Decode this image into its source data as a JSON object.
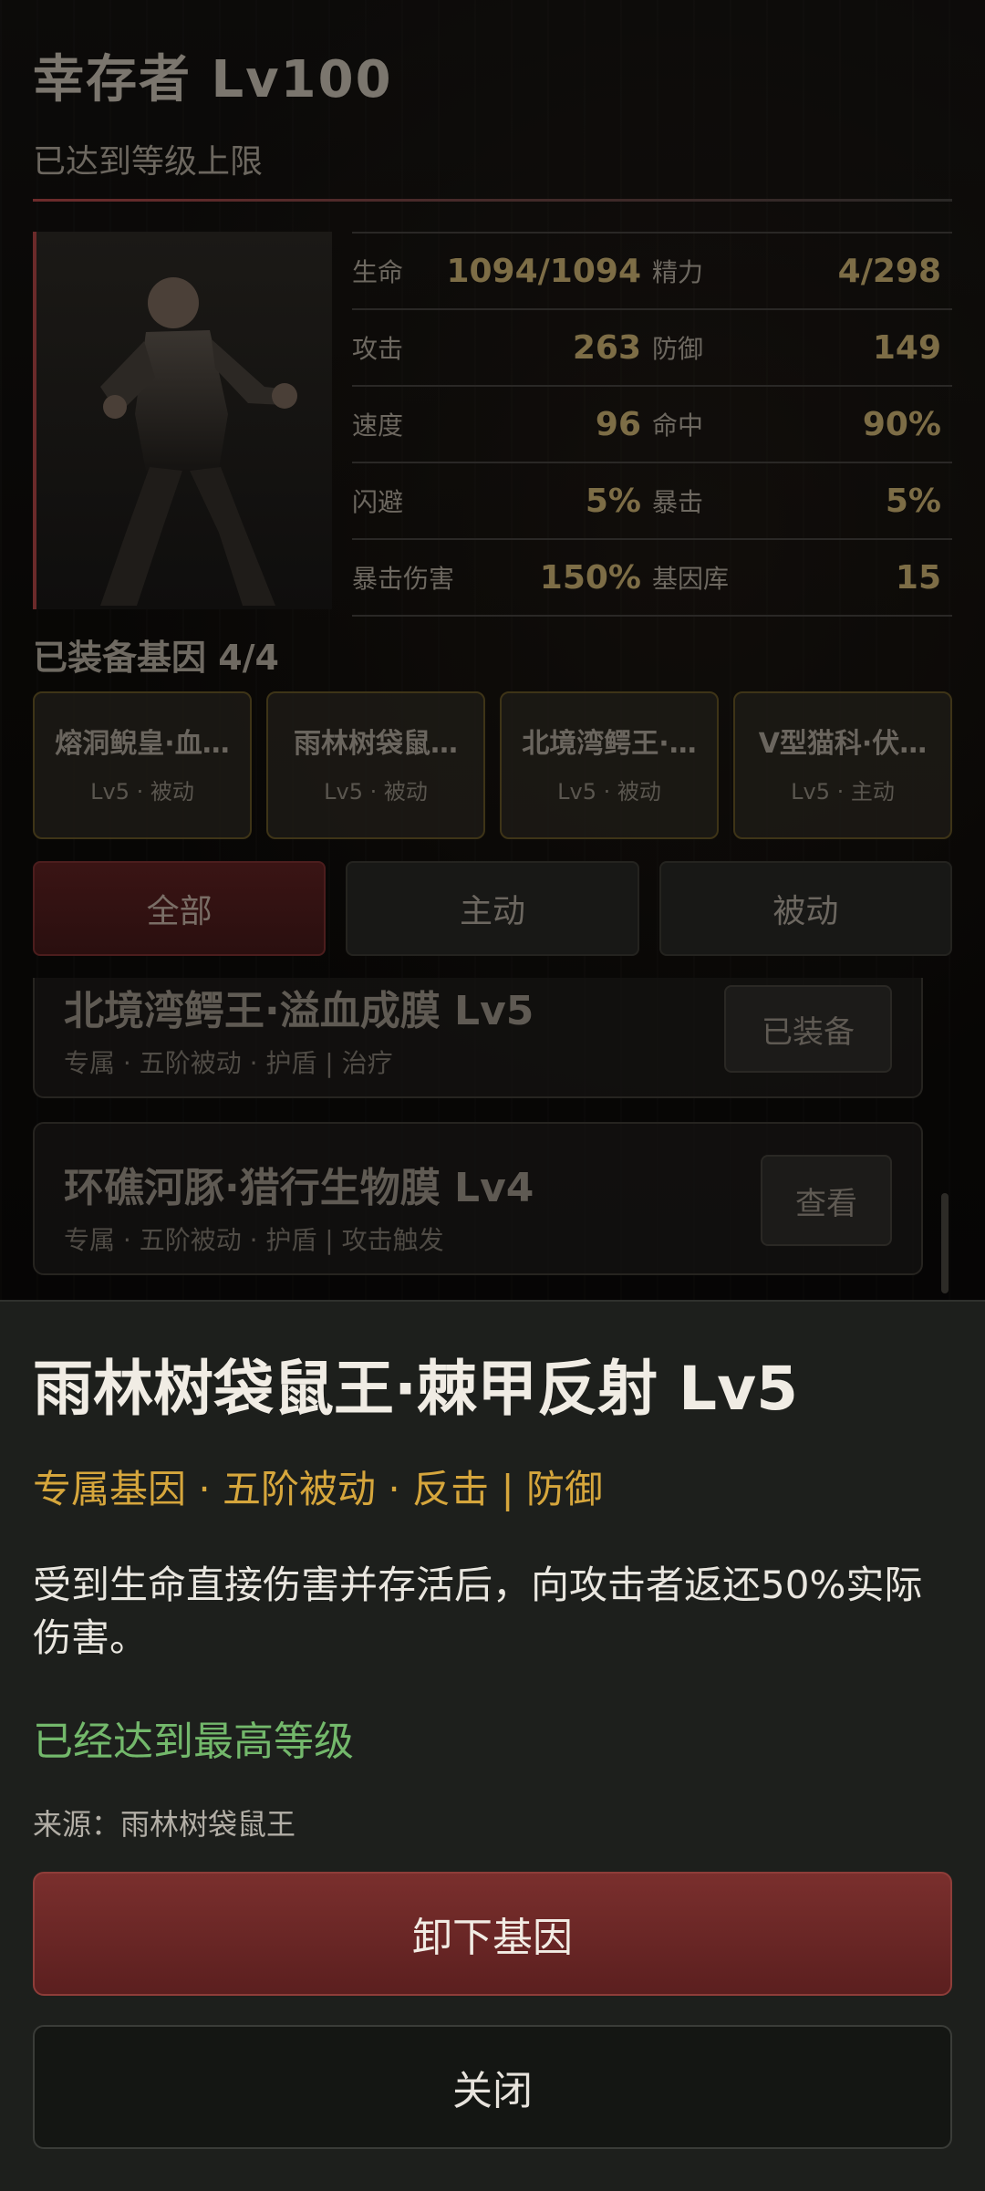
{
  "header": {
    "title": "幸存者 Lv100",
    "subtitle": "已达到等级上限"
  },
  "stats": [
    [
      {
        "label": "生命",
        "value": "1094/1094"
      },
      {
        "label": "精力",
        "value": "4/298"
      }
    ],
    [
      {
        "label": "攻击",
        "value": "263"
      },
      {
        "label": "防御",
        "value": "149"
      }
    ],
    [
      {
        "label": "速度",
        "value": "96"
      },
      {
        "label": "命中",
        "value": "90%"
      }
    ],
    [
      {
        "label": "闪避",
        "value": "5%"
      },
      {
        "label": "暴击",
        "value": "5%"
      }
    ],
    [
      {
        "label": "暴击伤害",
        "value": "150%"
      },
      {
        "label": "基因库",
        "value": "15"
      }
    ]
  ],
  "equipped": {
    "title": "已装备基因 4/4",
    "slots": [
      {
        "name": "熔洞鲵皇·血…",
        "meta": "Lv5 · 被动"
      },
      {
        "name": "雨林树袋鼠…",
        "meta": "Lv5 · 被动"
      },
      {
        "name": "北境湾鳄王·…",
        "meta": "Lv5 · 被动"
      },
      {
        "name": "V型猫科·伏…",
        "meta": "Lv5 · 主动"
      }
    ]
  },
  "filters": [
    "全部",
    "主动",
    "被动"
  ],
  "gene_list": [
    {
      "title": "北境湾鳄王·溢血成膜 Lv5",
      "sub": "专属 · 五阶被动 · 护盾 | 治疗",
      "button": "已装备"
    },
    {
      "title": "环礁河豚·猎行生物膜 Lv4",
      "sub": "专属 · 五阶被动 · 护盾 | 攻击触发",
      "button": "查看"
    }
  ],
  "detail": {
    "title": "雨林树袋鼠王·棘甲反射 Lv5",
    "tags": "专属基因 · 五阶被动 · 反击 | 防御",
    "description": "受到生命直接伤害并存活后，向攻击者返还50%实际伤害。",
    "status": "已经达到最高等级",
    "source": "来源：雨林树袋鼠王",
    "unequip_label": "卸下基因",
    "close_label": "关闭"
  },
  "colors": {
    "accent_red": "#7a2f2d",
    "tag_gold": "#d6a63c",
    "status_green": "#73b86b"
  }
}
